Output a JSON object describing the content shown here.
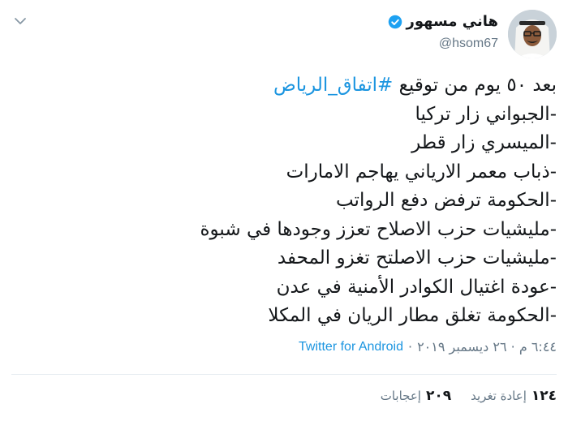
{
  "tweet": {
    "author": {
      "display_name": "هاني مسهور",
      "handle": "@hsom67",
      "verified_icon": "verified-badge-icon",
      "avatar_icon": "profile-avatar"
    },
    "menu_icon": "chevron-down-icon",
    "hashtag_line": {
      "prefix": "بعد ٥٠ يوم من توقيع ",
      "hashtag": "#اتفاق_الرياض"
    },
    "lines": [
      "-الجبواني زار تركيا",
      "-الميسري زار قطر",
      "-ذباب معمر الارياني يهاجم الامارات",
      "-الحكومة ترفض دفع الرواتب",
      "-مليشيات حزب الاصلاح تعزز وجودها في شبوة",
      "-مليشيات حزب الاصلتح تغزو المحفد",
      "-عودة اغتيال الكوادر الأمنية في عدن",
      "-الحكومة تغلق مطار الريان في المكلا"
    ],
    "meta": {
      "timestamp": "٦:٤٤ م · ٢٦ ديسمبر ٢٠١٩",
      "separator": "·",
      "source": "Twitter for Android"
    },
    "stats": {
      "retweets_count": "١٢٤",
      "retweets_label": "إعادة تغريد",
      "likes_count": "٢٠٩",
      "likes_label": "إعجابات"
    },
    "colors": {
      "link": "#1b95e0",
      "muted": "#657786",
      "text": "#14171a",
      "divider": "#e6ecf0"
    }
  }
}
